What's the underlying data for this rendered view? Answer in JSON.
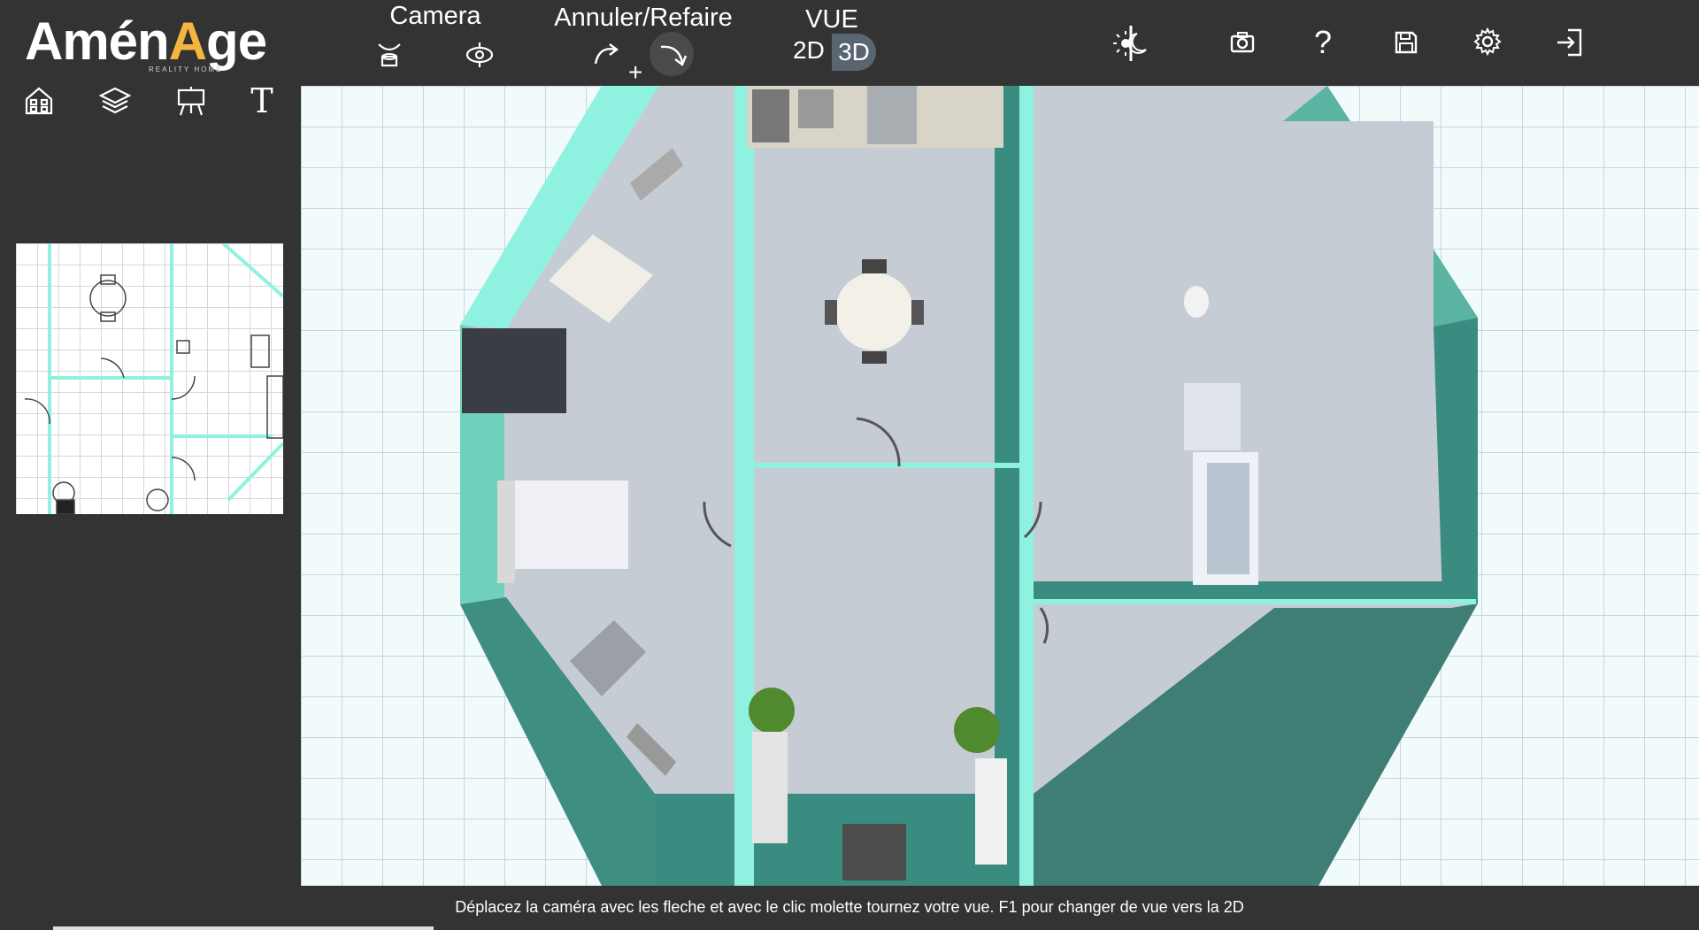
{
  "app": {
    "logo_main_prefix": "Amén",
    "logo_main_a": "A",
    "logo_main_suffix": "ge",
    "logo_sub": "REALITY HOME"
  },
  "toolbar": {
    "camera_title": "Camera",
    "undo_redo_title": "Annuler/Refaire",
    "undo_redo_plus": "+",
    "vue_title": "VUE",
    "vue_2d": "2D",
    "vue_3d": "3D",
    "vue_active": "3D"
  },
  "left_tools": [
    "home-plan-icon",
    "layers-icon",
    "easel-icon",
    "text-icon"
  ],
  "top_right_icons": [
    "day-night-icon",
    "camera-capture-icon",
    "help-icon",
    "save-icon",
    "settings-icon",
    "exit-icon"
  ],
  "help_glyph": "?",
  "text_tool_glyph": "T",
  "status": {
    "message": "Déplacez la caméra avec les fleche et avec le clic molette tournez votre vue. F1 pour changer de vue vers la 2D"
  },
  "colors": {
    "background": "#333333",
    "logo_accent": "#f4b63f",
    "canvas_bg": "#f1fbfc",
    "wall_cyan": "#8ff2e0",
    "wall_teal": "#3a8c80",
    "floor_gray": "#c6ccd3"
  }
}
